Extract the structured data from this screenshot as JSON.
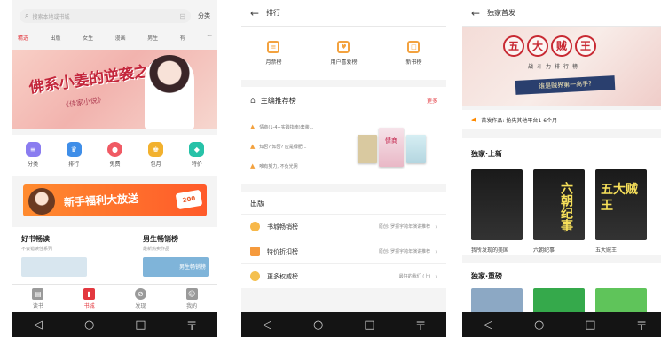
{
  "navbar": {
    "back": "◁",
    "home": "○",
    "recent": "□",
    "menu": "〒"
  },
  "screen1": {
    "search_placeholder": "搜索本地或书城",
    "classify_label": "分类",
    "tabs": [
      "精选",
      "出版",
      "女生",
      "漫画",
      "男生",
      "有",
      "···"
    ],
    "banner_title": "佛系小姜的逆袭之旅",
    "banner_sub": "《佳家小说》",
    "icons": [
      {
        "label": "分类",
        "color": "#8a7cf0"
      },
      {
        "label": "排行",
        "color": "#3f8ee8"
      },
      {
        "label": "免费",
        "color": "#f05a64"
      },
      {
        "label": "包月",
        "color": "#f2b12e"
      },
      {
        "label": "特价",
        "color": "#27c2a8"
      }
    ],
    "promo_text": "新手福利大放送",
    "promo_badge": "200",
    "left_head": "好书畅读",
    "left_sub": "不会错读佳系列",
    "right_head": "男生畅销榜",
    "right_sub": "最新热卖作品",
    "right_book_label": "男生畅销榜",
    "tabbar": [
      "读书",
      "书城",
      "发现",
      "我的"
    ]
  },
  "screen2": {
    "header": "排行",
    "ranks": [
      {
        "label": "月票榜",
        "glyph": "≡"
      },
      {
        "label": "用户喜爱榜",
        "glyph": "♥"
      },
      {
        "label": "新书榜",
        "glyph": "□"
      }
    ],
    "editor_title": "主编推荐榜",
    "editor_more": "更多",
    "editor_lines": [
      "情商(1-4+实践指南)套装...",
      "知否? 知否? 应是绿肥...",
      "唯有努力, 不负光阴"
    ],
    "cover_label": "情商",
    "section_title": "出版",
    "rows": [
      {
        "label": "书城畅销榜",
        "note": "原创: 罗振宇跨年演讲推荐",
        "color": "#f7b84a"
      },
      {
        "label": "特价折扣榜",
        "note": "原创: 罗振宇跨年演讲推荐",
        "color": "#f59a3d"
      },
      {
        "label": "更多权威榜",
        "note": "最好的我们 (上)",
        "color": "#f4c04f"
      }
    ]
  },
  "screen3": {
    "header": "独家首发",
    "seal_chars": [
      "五",
      "大",
      "贼",
      "王"
    ],
    "banner_sub": "战斗力排行榜",
    "banner_ribbon": "谁是贼界第一高手?",
    "notice": "首发作品: 抢先其他平台1-6个月",
    "new_title": "独家·上新",
    "books": [
      {
        "name": "我所发现的美国",
        "cover": "a",
        "cover_text": ""
      },
      {
        "name": "六朝纪事",
        "cover": "b",
        "cover_text": "六朝纪事"
      },
      {
        "name": "五大贼王",
        "cover": "c",
        "cover_text": "五大贼王"
      }
    ],
    "heavy_title": "独家·重磅",
    "heavy_colors": [
      "#8ca8c4",
      "#35a94b",
      "#5fc45a"
    ]
  }
}
